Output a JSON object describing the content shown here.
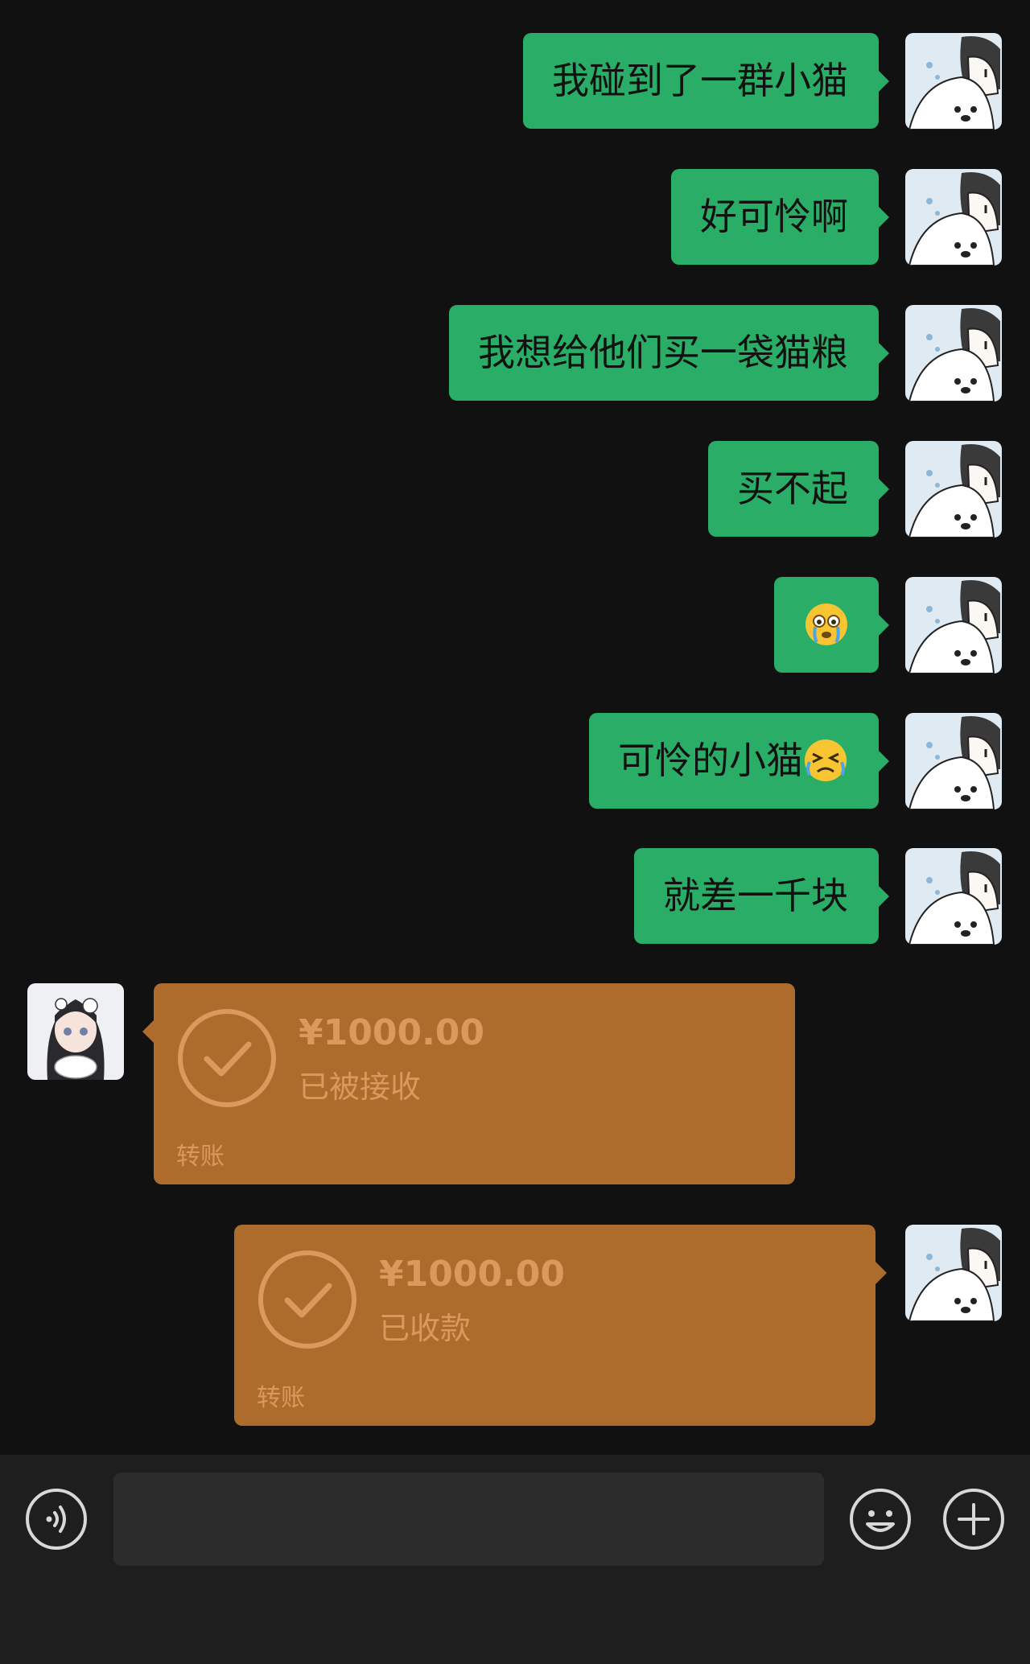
{
  "messages": [
    {
      "text": "我碰到了一群小猫"
    },
    {
      "text": "好可怜啊"
    },
    {
      "text": "我想给他们买一袋猫粮"
    },
    {
      "text": "买不起"
    },
    {
      "emoji": "crying-face-emoji"
    },
    {
      "text": "可怜的小猫",
      "emoji": "tearful-squint-face-emoji"
    },
    {
      "text": "就差一千块"
    }
  ],
  "transfers": [
    {
      "amount": "¥1000.00",
      "status": "已被接收",
      "kind": "转账"
    },
    {
      "amount": "¥1000.00",
      "status": "已收款",
      "kind": "转账"
    }
  ],
  "colors": {
    "background": "#111111",
    "sent_bubble": "#2aae67",
    "transfer_card": "#ad6b2c",
    "transfer_text": "#d99a5c",
    "input_bar": "#1e1e1e"
  },
  "icons": {
    "voice": "voice-icon",
    "emoji": "emoji-icon",
    "more": "plus-icon"
  }
}
